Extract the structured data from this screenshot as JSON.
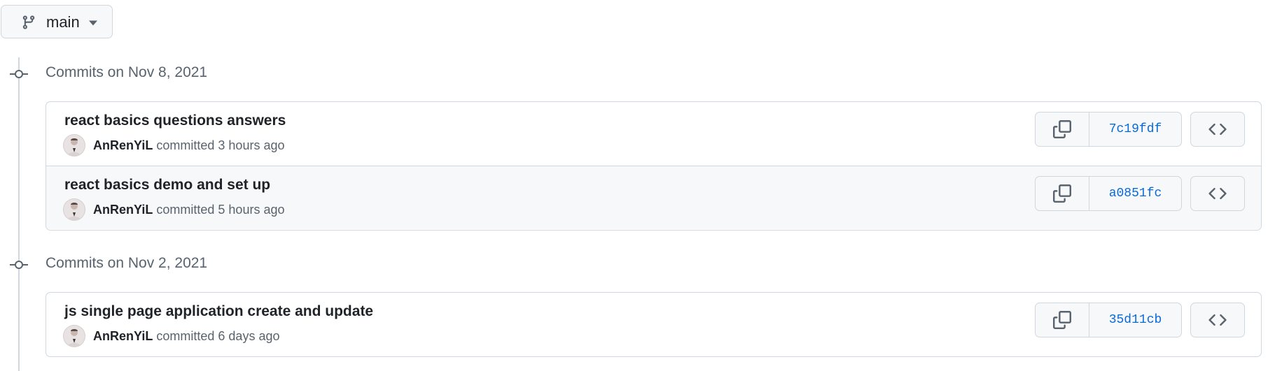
{
  "branch": {
    "name": "main",
    "icon": "git-branch-icon",
    "caret_icon": "triangle-down-icon"
  },
  "groups": [
    {
      "heading": "Commits on Nov 8, 2021",
      "commits": [
        {
          "title": "react basics questions answers",
          "author": "AnRenYiL",
          "action": "committed",
          "time": "3 hours ago",
          "sha": "7c19fdf"
        },
        {
          "title": "react basics demo and set up",
          "author": "AnRenYiL",
          "action": "committed",
          "time": "5 hours ago",
          "sha": "a0851fc"
        }
      ]
    },
    {
      "heading": "Commits on Nov 2, 2021",
      "commits": [
        {
          "title": "js single page application create and update",
          "author": "AnRenYiL",
          "action": "committed",
          "time": "6 days ago",
          "sha": "35d11cb"
        }
      ]
    }
  ],
  "icons": {
    "copy": "copy-icon",
    "browse": "code-icon",
    "timeline_node": "commit-node-icon"
  },
  "colors": {
    "sha_link": "#0969da",
    "border": "#d0d7de",
    "muted_text": "#59636e",
    "alt_row_bg": "#f6f8fa"
  }
}
